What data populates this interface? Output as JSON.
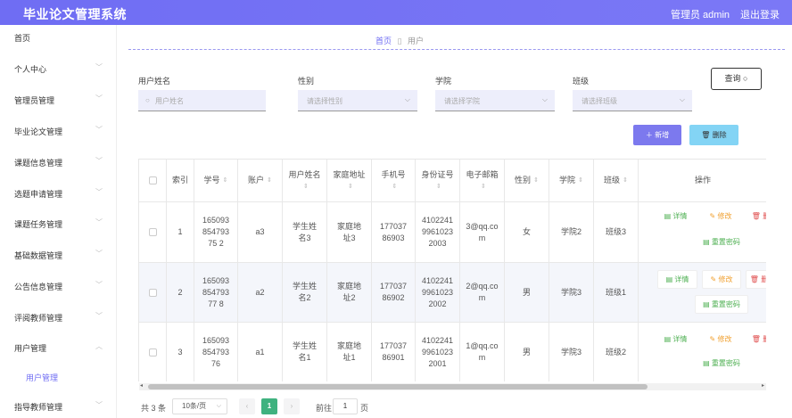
{
  "header": {
    "title": "毕业论文管理系统",
    "user": "管理员 admin",
    "logout": "退出登录"
  },
  "sidebar": {
    "items": [
      {
        "label": "首页",
        "chevron": ""
      },
      {
        "label": "个人中心",
        "chevron": "﹀"
      },
      {
        "label": "管理员管理",
        "chevron": "﹀"
      },
      {
        "label": "毕业论文管理",
        "chevron": "﹀"
      },
      {
        "label": "课题信息管理",
        "chevron": "﹀"
      },
      {
        "label": "选题申请管理",
        "chevron": "﹀"
      },
      {
        "label": "课题任务管理",
        "chevron": "﹀"
      },
      {
        "label": "基础数据管理",
        "chevron": "﹀"
      },
      {
        "label": "公告信息管理",
        "chevron": "﹀"
      },
      {
        "label": "评阅教师管理",
        "chevron": "﹀"
      },
      {
        "label": "用户管理",
        "chevron": "︿"
      }
    ],
    "sub_item": "用户管理",
    "last_item": {
      "label": "指导教师管理",
      "chevron": "﹀"
    }
  },
  "breadcrumb": {
    "home": "首页",
    "current": "用户"
  },
  "filters": {
    "name_label": "用户姓名",
    "name_placeholder": "用户姓名",
    "gender_label": "性别",
    "gender_placeholder": "请选择性别",
    "college_label": "学院",
    "college_placeholder": "请选择学院",
    "class_label": "班级",
    "class_placeholder": "请选择班级",
    "search_button": "查询"
  },
  "actions": {
    "add": "新增",
    "delete": "删除"
  },
  "table": {
    "headers": [
      "索引",
      "学号",
      "账户",
      "用户姓名",
      "家庭地址",
      "手机号",
      "身份证号",
      "电子邮箱",
      "性别",
      "学院",
      "班级",
      "操作"
    ],
    "rows": [
      {
        "index": "1",
        "student_no": "16509385479375 2",
        "account": "a3",
        "name": "学生姓名3",
        "address": "家庭地址3",
        "phone": "17703786903",
        "id_card": "410224199610232003",
        "email": "3@qq.com",
        "gender": "女",
        "college": "学院2",
        "class": "班级3"
      },
      {
        "index": "2",
        "student_no": "16509385479377 8",
        "account": "a2",
        "name": "学生姓名2",
        "address": "家庭地址2",
        "phone": "17703786902",
        "id_card": "410224199610232002",
        "email": "2@qq.com",
        "gender": "男",
        "college": "学院3",
        "class": "班级1"
      },
      {
        "index": "3",
        "student_no": "16509385479376",
        "account": "a1",
        "name": "学生姓名1",
        "address": "家庭地址1",
        "phone": "17703786901",
        "id_card": "410224199610232001",
        "email": "1@qq.com",
        "gender": "男",
        "college": "学院3",
        "class": "班级2"
      }
    ],
    "ops": {
      "detail": "详情",
      "edit": "修改",
      "delete": "删",
      "reset_pwd": "重置密码"
    }
  },
  "pagination": {
    "total": "共 3 条",
    "page_size": "10条/页",
    "current_page": "1",
    "goto_label": "前往",
    "goto_value": "1",
    "goto_unit": "页"
  },
  "colors": {
    "primary": "#6f6df3",
    "header": "#7673f3",
    "success": "#3fb27f",
    "info": "#83d4f5"
  }
}
